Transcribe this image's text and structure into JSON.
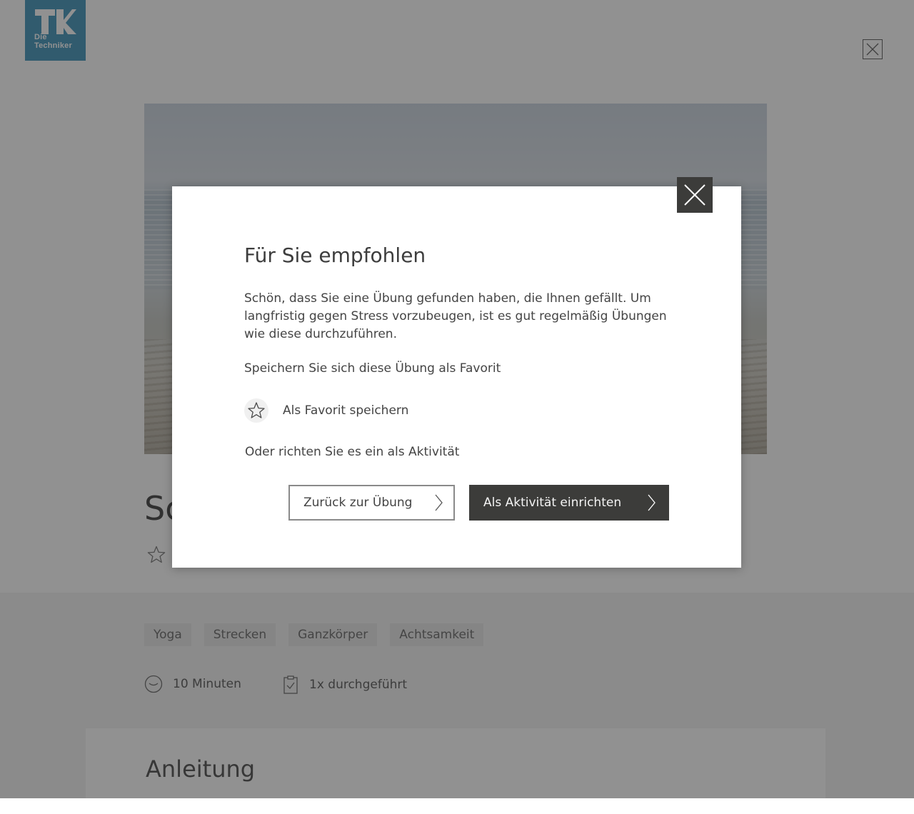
{
  "logo": {
    "line1": "Die",
    "line2": "Techniker"
  },
  "background": {
    "title_visible": "Sc",
    "tags": [
      "Yoga",
      "Strecken",
      "Ganzkörper",
      "Achtsamkeit"
    ],
    "duration": "10 Minuten",
    "completed": "1x durchgeführt",
    "instructions_title": "Anleitung"
  },
  "modal": {
    "title": "Für Sie empfohlen",
    "text": "Schön, dass Sie eine Übung gefunden haben, die Ihnen gefällt. Um langfristig gegen Stress vorzubeugen, ist es gut regelmäßig Übungen wie diese durchzuführen.",
    "favorite_prompt": "Speichern Sie sich diese Übung als Favorit",
    "favorite_label": "Als Favorit speichern",
    "activity_prompt": "Oder richten Sie es ein als Aktivität",
    "back_button": "Zurück zur Übung",
    "activity_button": "Als Aktivität einrichten"
  },
  "colors": {
    "brand": "#3f92b9",
    "dark_button": "#3c3c3a",
    "overlay": "rgba(36,36,36,0.5)"
  },
  "icons": [
    "close-icon",
    "star-icon",
    "clock-icon",
    "clipboard-check-icon",
    "chevron-right-icon"
  ]
}
